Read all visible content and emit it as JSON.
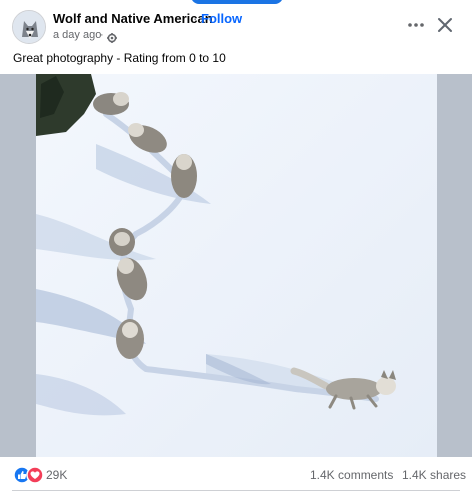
{
  "post": {
    "page_name": "Wolf and Native American",
    "follow_label": "Follow",
    "separator": "·",
    "time": "a day ago",
    "time_separator": "·",
    "audience_icon": "gear-icon",
    "caption": "Great photography - Rating from 0 to 10"
  },
  "header_actions": {
    "more_icon": "more-horizontal-icon",
    "close_icon": "close-icon"
  },
  "engagement": {
    "reactions": [
      "like",
      "love"
    ],
    "reaction_count": "29K",
    "comments": "1.4K comments",
    "shares": "1.4K shares"
  },
  "colors": {
    "link": "#0866ff",
    "like": "#1877f2",
    "love": "#f33e58",
    "secondary_text": "#65676b",
    "snow": "#eef3fb",
    "shadow": "#8ea3c4"
  }
}
